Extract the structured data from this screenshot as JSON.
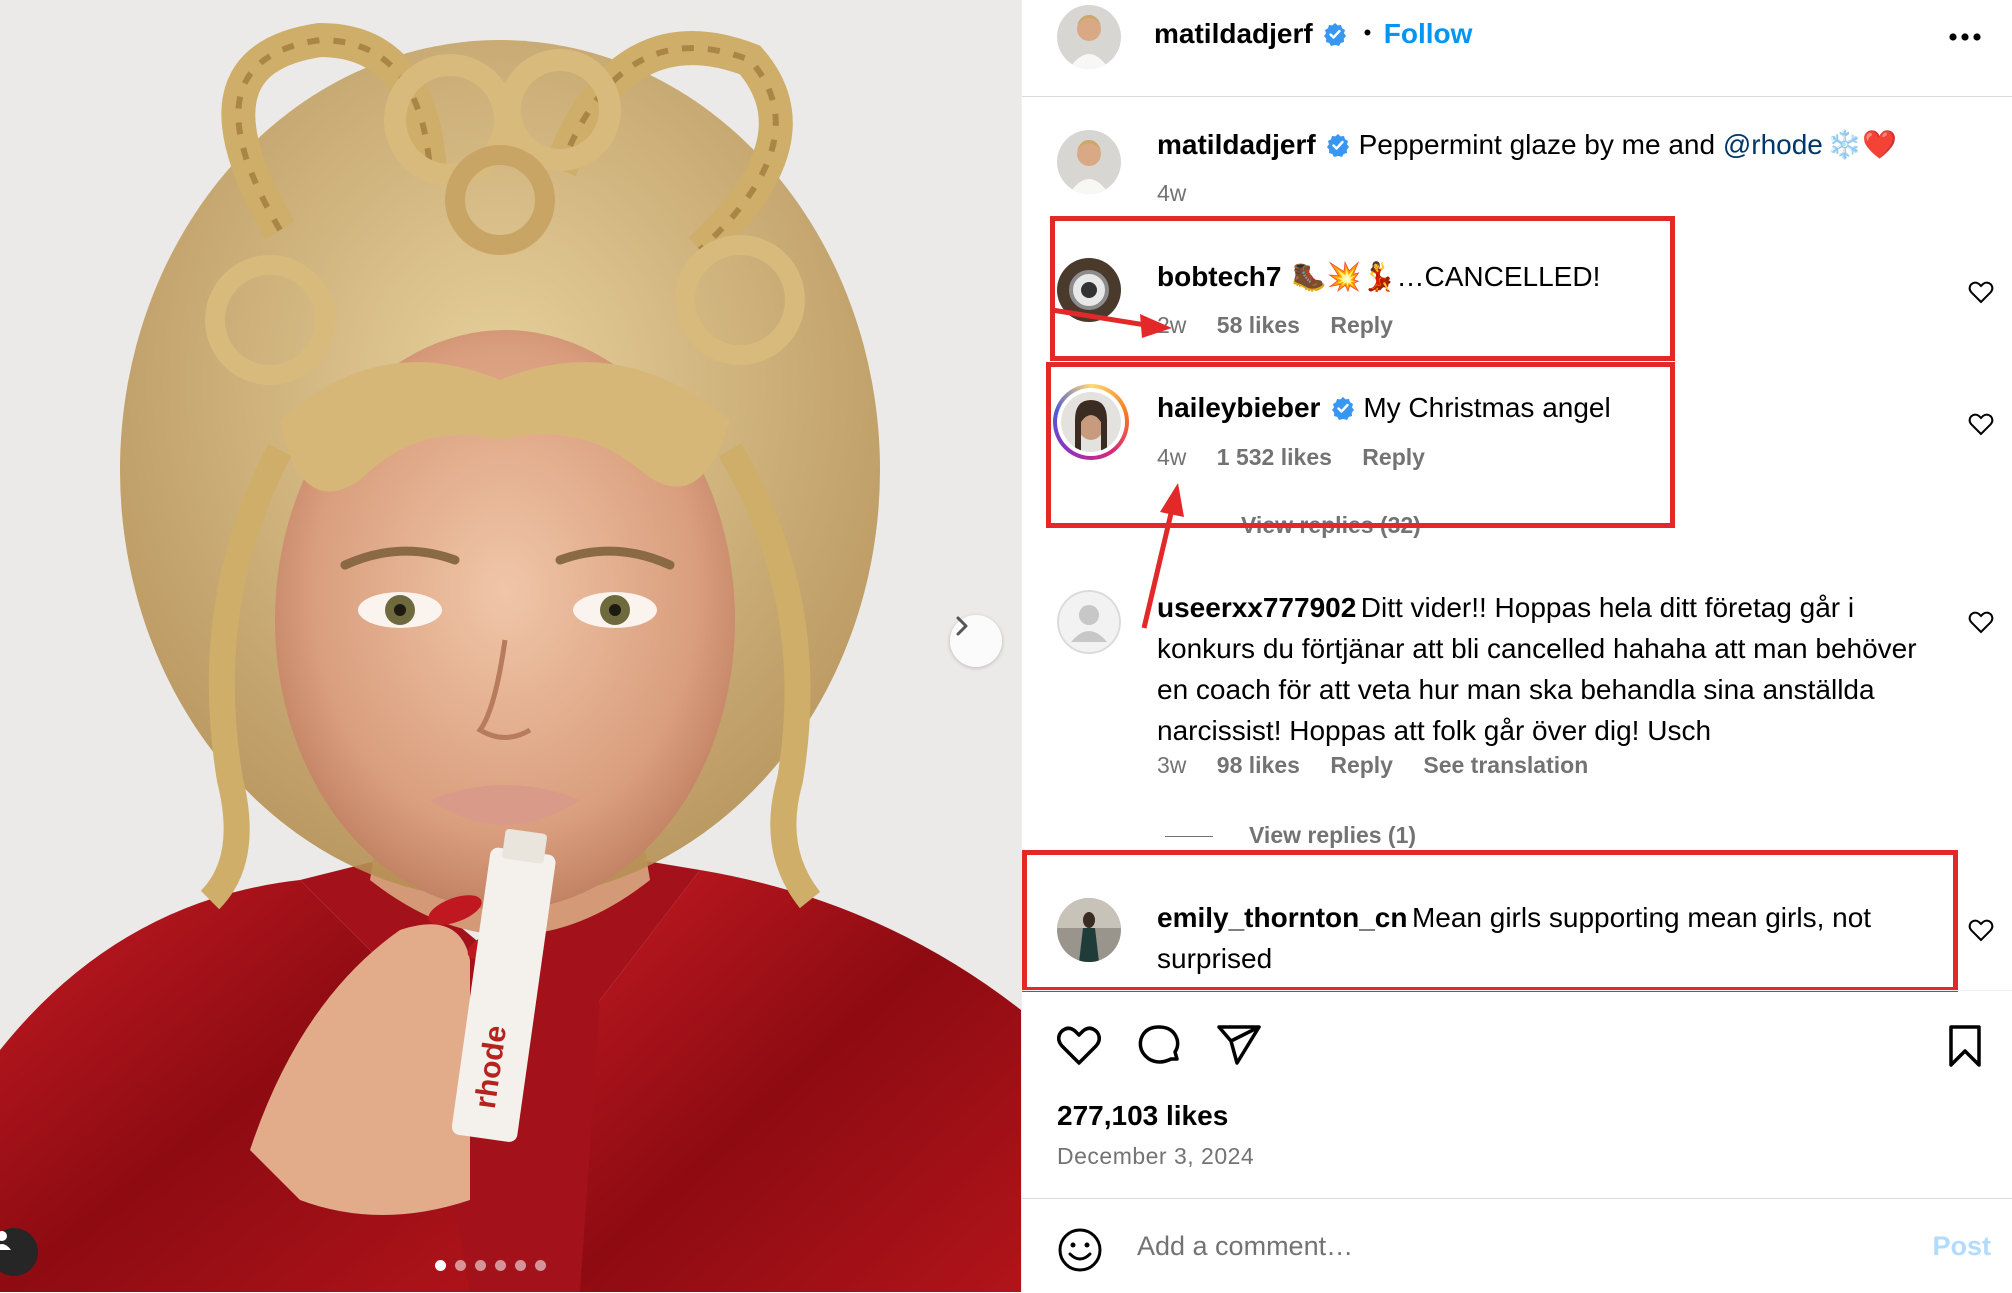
{
  "header": {
    "username": "matildadjerf",
    "separator": "•",
    "follow_label": "Follow",
    "more_icon": "more-horizontal-icon"
  },
  "caption": {
    "username": "matildadjerf",
    "text_before": "Peppermint glaze by me and ",
    "mention": "@rhode",
    "emoji": "❄️❤️",
    "time": "4w"
  },
  "comments": [
    {
      "username": "bobtech7",
      "text": "🥾💥💃…CANCELLED!",
      "time": "2w",
      "likes": "58 likes",
      "reply": "Reply",
      "verified": false
    },
    {
      "username": "haileybieber",
      "text": "My Christmas angel",
      "time": "4w",
      "likes": "1 532 likes",
      "reply": "Reply",
      "verified": true,
      "view_replies": "View replies (32)"
    },
    {
      "username": "useerxx777902",
      "text": "Ditt vider!! Hoppas hela ditt företag går i konkurs du förtjänar att bli cancelled hahaha att man behöver en coach för att veta hur man ska behandla sina anställda narcissist! Hoppas att folk går över dig! Usch",
      "time": "3w",
      "likes": "98 likes",
      "reply": "Reply",
      "translate": "See translation",
      "view_replies": "View replies (1)"
    },
    {
      "username": "emily_thornton_cn",
      "text": "Mean girls supporting mean girls, not surprised"
    }
  ],
  "footer": {
    "likes": "277,103 likes",
    "date": "December 3, 2024",
    "add_comment_placeholder": "Add a comment…",
    "post_label": "Post"
  },
  "media": {
    "product_text": "rhode",
    "slides_total": 6,
    "slide_active": 1
  },
  "colors": {
    "accent": "#0095f6",
    "annotation": "#e22828",
    "verified": "#3897f0",
    "muted": "#737373"
  }
}
